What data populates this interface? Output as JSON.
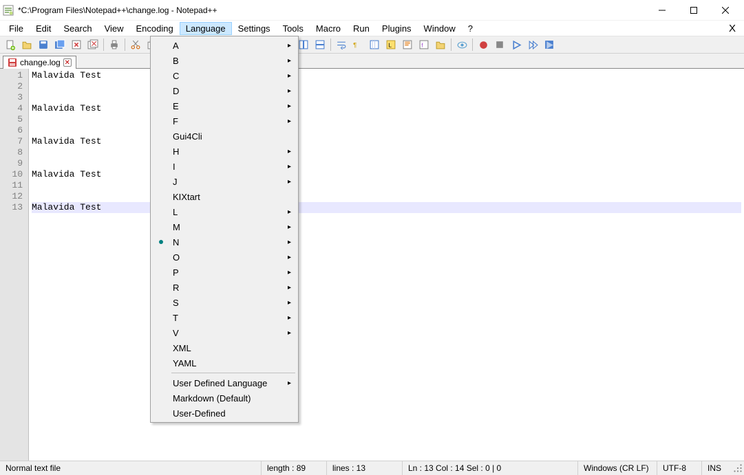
{
  "title": "*C:\\Program Files\\Notepad++\\change.log - Notepad++",
  "menubar": [
    "File",
    "Edit",
    "Search",
    "View",
    "Encoding",
    "Language",
    "Settings",
    "Tools",
    "Macro",
    "Run",
    "Plugins",
    "Window",
    "?"
  ],
  "menubar_active_index": 5,
  "tab": {
    "label": "change.log"
  },
  "gutter_lines": [
    "1",
    "2",
    "3",
    "4",
    "5",
    "6",
    "7",
    "8",
    "9",
    "10",
    "11",
    "12",
    "13"
  ],
  "code_lines": [
    "Malavida Test",
    "",
    "",
    "Malavida Test",
    "",
    "",
    "Malavida Test",
    "",
    "",
    "Malavida Test",
    "",
    "",
    "Malavida Test"
  ],
  "current_line_index": 12,
  "dropdown": {
    "groups": [
      [
        {
          "label": "A",
          "sub": true
        },
        {
          "label": "B",
          "sub": true
        },
        {
          "label": "C",
          "sub": true
        },
        {
          "label": "D",
          "sub": true
        },
        {
          "label": "E",
          "sub": true
        },
        {
          "label": "F",
          "sub": true
        },
        {
          "label": "Gui4Cli",
          "sub": false
        },
        {
          "label": "H",
          "sub": true
        },
        {
          "label": "I",
          "sub": true
        },
        {
          "label": "J",
          "sub": true
        },
        {
          "label": "KIXtart",
          "sub": false
        },
        {
          "label": "L",
          "sub": true
        },
        {
          "label": "M",
          "sub": true
        },
        {
          "label": "N",
          "sub": true,
          "selected": true
        },
        {
          "label": "O",
          "sub": true
        },
        {
          "label": "P",
          "sub": true
        },
        {
          "label": "R",
          "sub": true
        },
        {
          "label": "S",
          "sub": true
        },
        {
          "label": "T",
          "sub": true
        },
        {
          "label": "V",
          "sub": true
        },
        {
          "label": "XML",
          "sub": false
        },
        {
          "label": "YAML",
          "sub": false
        }
      ],
      [
        {
          "label": "User Defined Language",
          "sub": true
        },
        {
          "label": "Markdown (Default)",
          "sub": false
        },
        {
          "label": "User-Defined",
          "sub": false
        }
      ]
    ]
  },
  "status": {
    "filetype": "Normal text file",
    "length": "length : 89",
    "lines": "lines : 13",
    "pos": "Ln : 13    Col : 14    Sel : 0 | 0",
    "eol": "Windows (CR LF)",
    "enc": "UTF-8",
    "ins": "INS"
  },
  "toolbar_icons": [
    "new-file",
    "open",
    "save",
    "save-all",
    "close",
    "close-all",
    "print",
    "cut",
    "copy",
    "paste",
    "undo",
    "redo",
    "find",
    "replace",
    "zoom-in",
    "zoom-out",
    "sync-v",
    "sync-h",
    "wrap",
    "show-all",
    "indent-guide",
    "udl",
    "doc-map",
    "func-list",
    "folder",
    "monitor",
    "record",
    "stop",
    "play",
    "play-multi",
    "save-macro"
  ]
}
